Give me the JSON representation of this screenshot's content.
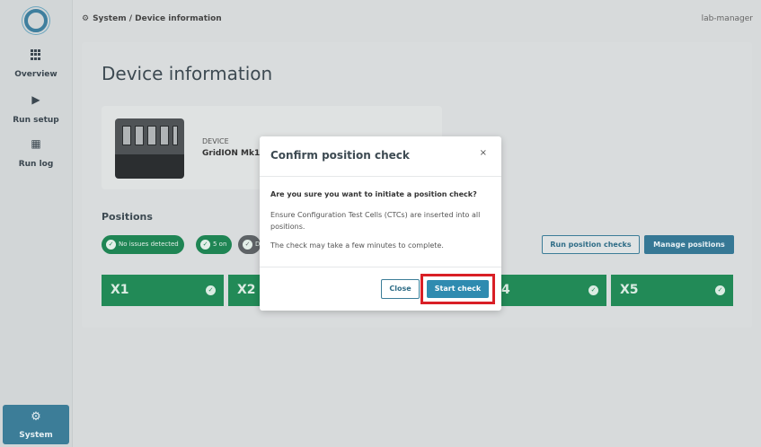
{
  "sidebar": {
    "items": [
      {
        "label": "Overview",
        "icon": "grid-icon"
      },
      {
        "label": "Run setup",
        "icon": "play-icon"
      },
      {
        "label": "Run log",
        "icon": "file-icon"
      }
    ],
    "system": {
      "label": "System",
      "icon": "gear-icon"
    }
  },
  "header": {
    "breadcrumb": "System / Device information",
    "user": "lab-manager"
  },
  "page": {
    "title": "Device information",
    "device_kicker": "DEVICE",
    "device_name": "GridION Mk1"
  },
  "positions": {
    "title": "Positions",
    "badges": [
      "No issues detected",
      "5 on",
      "D"
    ],
    "run_checks_label": "Run position checks",
    "manage_label": "Manage positions",
    "tiles": [
      "X1",
      "X2",
      "4",
      "X5"
    ]
  },
  "modal": {
    "title": "Confirm position check",
    "close_x": "×",
    "question": "Are you sure you want to initiate a position check?",
    "para1": "Ensure Configuration Test Cells (CTCs) are inserted into all positions.",
    "para2": "The check may take a few minutes to complete.",
    "close_label": "Close",
    "start_label": "Start check"
  },
  "colors": {
    "accent": "#367895",
    "success": "#228a57",
    "highlight": "#d91f26"
  }
}
